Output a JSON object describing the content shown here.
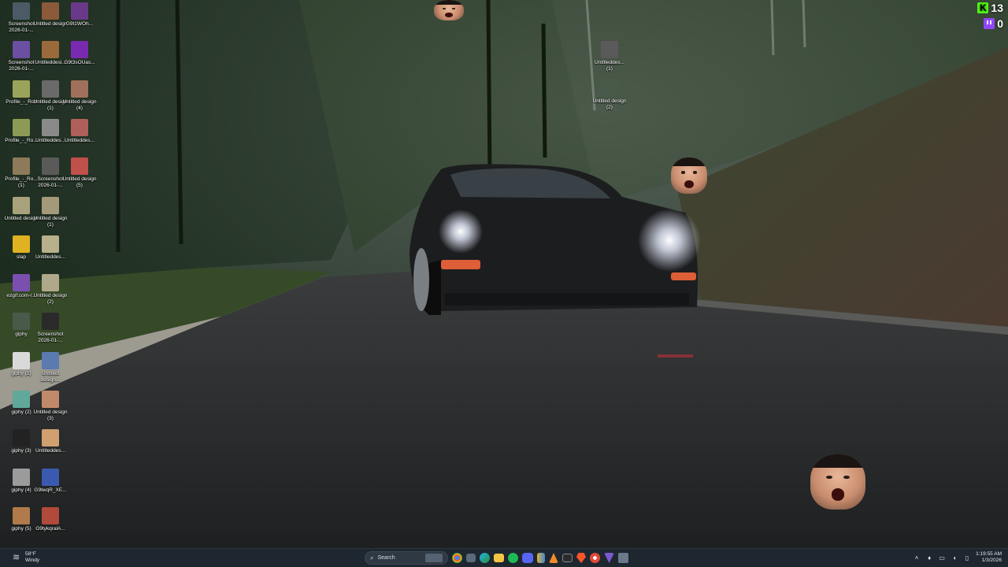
{
  "desktop": {
    "icons_col1": [
      {
        "label": "Screenshot 2026-01-...",
        "icon": "screenshot-icon",
        "color": "#4b5a66"
      },
      {
        "label": "Screenshot 2026-01-...",
        "icon": "screenshot-icon",
        "color": "#6a4fa3"
      },
      {
        "label": "Profile_-_Roz",
        "icon": "image-icon",
        "color": "#9aa35a"
      },
      {
        "label": "Profile_-_Ro...",
        "icon": "image-icon",
        "color": "#8d9a55"
      },
      {
        "label": "Profile_-_Ro... (1)",
        "icon": "image-icon",
        "color": "#8c7a5a"
      },
      {
        "label": "Untitled design",
        "icon": "image-icon",
        "color": "#a7a27b"
      },
      {
        "label": "slap",
        "icon": "image-icon",
        "color": "#e0b222"
      },
      {
        "label": "ezgif.com-r...",
        "icon": "gif-icon",
        "color": "#7a4fb0"
      },
      {
        "label": "giphy",
        "icon": "gif-icon",
        "color": "#4a5a4a"
      },
      {
        "label": "giphy (1)",
        "icon": "gif-icon",
        "color": "#d9d9d9"
      },
      {
        "label": "giphy (2)",
        "icon": "gif-icon",
        "color": "#5fa89a"
      },
      {
        "label": "giphy (3)",
        "icon": "gif-icon",
        "color": "#222222"
      },
      {
        "label": "giphy (4)",
        "icon": "gif-icon",
        "color": "#9b9b9b"
      },
      {
        "label": "giphy (5)",
        "icon": "gif-icon",
        "color": "#b07a4a"
      }
    ],
    "icons_col2": [
      {
        "label": "Untitled design",
        "icon": "image-icon",
        "color": "#8a5a3a"
      },
      {
        "label": "Untitleddesi...",
        "icon": "image-icon",
        "color": "#9a6a3a"
      },
      {
        "label": "Untitled design (1)",
        "icon": "image-icon",
        "color": "#6a6a6a"
      },
      {
        "label": "Untitleddes...",
        "icon": "image-icon",
        "color": "#8a8a8a"
      },
      {
        "label": "Screenshot 2026-01-...",
        "icon": "screenshot-icon",
        "color": "#5a5a5a"
      },
      {
        "label": "Untitled design (1)",
        "icon": "image-icon",
        "color": "#a49a7a"
      },
      {
        "label": "Untitleddes...",
        "icon": "image-icon",
        "color": "#b8b08a"
      },
      {
        "label": "Untitled design (2)",
        "icon": "image-icon",
        "color": "#b0a88a"
      },
      {
        "label": "Screenshot 2026-01-...",
        "icon": "screenshot-icon",
        "color": "#2a2a2a"
      },
      {
        "label": "Untitled design...",
        "icon": "image-icon",
        "color": "#5a7ab0"
      },
      {
        "label": "Untitled design (3)",
        "icon": "image-icon",
        "color": "#c08a6a"
      },
      {
        "label": "Untitleddes...",
        "icon": "image-icon",
        "color": "#d0a070"
      },
      {
        "label": "G9twqR_XE...",
        "icon": "image-icon",
        "color": "#3a5ab0"
      },
      {
        "label": "G9tykqralA...",
        "icon": "image-icon",
        "color": "#b04a3a"
      }
    ],
    "icons_col3": [
      {
        "label": "G9t1WOh...",
        "icon": "image-icon",
        "color": "#6a3a8a"
      },
      {
        "label": "G9t3sOUas...",
        "icon": "image-icon",
        "color": "#7a2ab0"
      },
      {
        "label": "Untitled design (4)",
        "icon": "image-icon",
        "color": "#a0705a"
      },
      {
        "label": "Untitleddes...",
        "icon": "image-icon",
        "color": "#b0605a"
      },
      {
        "label": "Untitled design (5)",
        "icon": "image-icon",
        "color": "#c0504a"
      }
    ],
    "icons_mid": [
      {
        "label": "Untitleddes... (1)",
        "icon": "image-icon",
        "color": "#5a5a5a"
      },
      {
        "label": "Untitled design (2)",
        "icon": "image-icon",
        "color": "#4a5a4a"
      }
    ]
  },
  "overlay": {
    "kick_count": "13",
    "twitch_count": "0",
    "kick_color": "#53fc18",
    "twitch_color": "#9146ff"
  },
  "taskbar": {
    "weather_temp": "58°F",
    "weather_desc": "Windy",
    "search_placeholder": "Search",
    "apps": [
      "chrome-icon",
      "task-view-icon",
      "edge-icon",
      "file-explorer-icon",
      "spotify-icon",
      "discord-icon",
      "files-icon",
      "vlc-icon",
      "terminal-icon",
      "brave-icon",
      "settings-icon",
      "vs-icon",
      "app-icon"
    ],
    "time": "1:19:55 AM",
    "date": "1/3/2026"
  }
}
